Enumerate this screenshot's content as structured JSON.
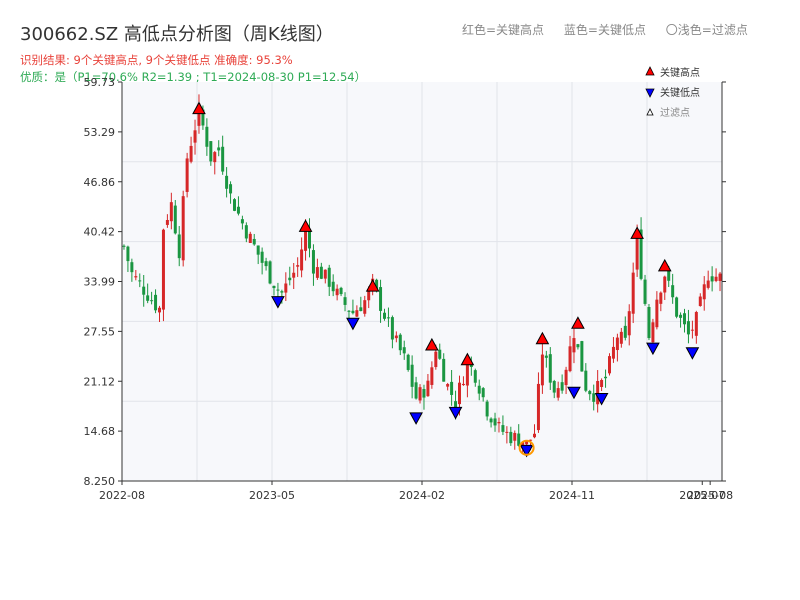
{
  "chart_data": {
    "type": "candlestick",
    "title": "300662.SZ 高低点分析图（周K线图）",
    "info_line1": "识别结果: 9个关键高点, 9个关键低点  准确度: 95.3%",
    "info_line2": "优质：是（P1=70.6%  R2=1.39 ; T1=2024-08-30 P1=12.54）",
    "top_legend": [
      "红色=关键高点",
      "蓝色=关键低点",
      "〇浅色=过滤点"
    ],
    "legend": [
      "关键高点",
      "关键低点",
      "过滤点"
    ],
    "y_ticks": [
      "8.250",
      "14.68",
      "21.12",
      "27.55",
      "33.99",
      "40.42",
      "46.86",
      "53.29",
      "59.73"
    ],
    "ylim": [
      8.25,
      59.73
    ],
    "x_ticks": [
      "2022-08",
      "2023-05",
      "2024-02",
      "2024-11",
      "2025-07",
      "2025-08"
    ],
    "x_tick_positions": [
      0,
      38,
      76,
      114,
      147,
      149
    ],
    "n_weeks": 152,
    "grid": true,
    "colors": {
      "up": "#d62728",
      "down": "#1a9641",
      "high_marker": "#ff0000",
      "low_marker": "#0000ff",
      "filter_marker": "#ff9900",
      "info1": "#e8423a",
      "info2": "#2eaa55"
    },
    "anchors": [
      [
        0,
        38.5
      ],
      [
        2,
        35
      ],
      [
        5,
        33
      ],
      [
        8,
        31
      ],
      [
        9,
        30.5
      ],
      [
        10,
        41
      ],
      [
        12,
        44
      ],
      [
        14,
        38
      ],
      [
        16,
        50
      ],
      [
        19,
        56
      ],
      [
        22,
        50
      ],
      [
        24,
        51
      ],
      [
        27,
        45
      ],
      [
        30,
        41.5
      ],
      [
        33,
        38.5
      ],
      [
        36,
        35.5
      ],
      [
        39,
        33
      ],
      [
        40,
        32.5
      ],
      [
        44,
        36
      ],
      [
        46,
        40.5
      ],
      [
        48,
        36
      ],
      [
        52,
        34
      ],
      [
        55,
        31.5
      ],
      [
        58,
        30
      ],
      [
        61,
        31.5
      ],
      [
        63,
        33.5
      ],
      [
        65,
        31
      ],
      [
        68,
        27
      ],
      [
        71,
        24
      ],
      [
        74,
        19
      ],
      [
        77,
        20.5
      ],
      [
        79,
        25.5
      ],
      [
        82,
        20.5
      ],
      [
        84,
        18.5
      ],
      [
        87,
        23.5
      ],
      [
        89,
        22
      ],
      [
        92,
        17.5
      ],
      [
        95,
        15
      ],
      [
        98,
        14
      ],
      [
        101,
        13.5
      ],
      [
        102,
        12.9
      ],
      [
        104,
        14.5
      ],
      [
        106,
        25
      ],
      [
        109,
        20
      ],
      [
        111,
        21
      ],
      [
        114,
        27.5
      ],
      [
        117,
        20.5
      ],
      [
        119,
        19.5
      ],
      [
        122,
        21.5
      ],
      [
        125,
        27
      ],
      [
        127,
        26
      ],
      [
        130,
        39.5
      ],
      [
        133,
        27
      ],
      [
        135,
        32
      ],
      [
        137,
        35
      ],
      [
        140,
        30
      ],
      [
        143,
        27
      ],
      [
        145,
        29
      ],
      [
        148,
        35
      ],
      [
        151,
        34.5
      ]
    ],
    "key_highs": [
      [
        19,
        56.3
      ],
      [
        46,
        41.1
      ],
      [
        63,
        33.4
      ],
      [
        78,
        25.8
      ],
      [
        87,
        23.9
      ],
      [
        106,
        26.6
      ],
      [
        115,
        28.6
      ],
      [
        130,
        40.2
      ],
      [
        137,
        36.0
      ]
    ],
    "key_lows": [
      [
        39,
        31.4
      ],
      [
        58,
        28.6
      ],
      [
        74,
        16.4
      ],
      [
        84,
        17.1
      ],
      [
        102,
        12.2
      ],
      [
        114,
        19.7
      ],
      [
        121,
        18.9
      ],
      [
        134,
        25.4
      ],
      [
        144,
        24.8
      ]
    ],
    "filter_points": [
      [
        102,
        12.54
      ]
    ]
  }
}
